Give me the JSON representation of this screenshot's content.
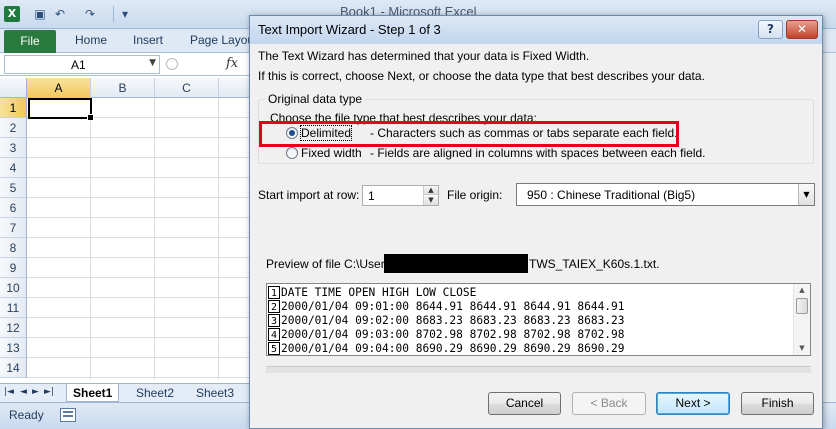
{
  "excel": {
    "window_title": "Book1 - Microsoft Excel",
    "app_logo": "X",
    "qat_icons": [
      "save-icon",
      "undo-icon",
      "redo-icon",
      "customize-qat-icon"
    ],
    "tabs": [
      "File",
      "Home",
      "Insert",
      "Page Layou"
    ],
    "name_box": "A1",
    "fx": "fx",
    "columns": [
      "A",
      "B",
      "C"
    ],
    "rows": [
      "1",
      "2",
      "3",
      "4",
      "5",
      "6",
      "7",
      "8",
      "9",
      "10",
      "11",
      "12",
      "13",
      "14"
    ],
    "sheets": [
      "Sheet1",
      "Sheet2",
      "Sheet3"
    ],
    "active_sheet": "Sheet1",
    "status": "Ready",
    "sheet_nav": [
      "|◄",
      "◄",
      "►",
      "►|"
    ]
  },
  "dialog": {
    "title": "Text Import Wizard - Step 1 of 3",
    "help_label": "?",
    "close_label": "✕",
    "intro_line1": "The Text Wizard has determined that your data is Fixed Width.",
    "intro_line2": "If this is correct, choose Next, or choose the data type that best describes your data.",
    "group_title": "Original data type",
    "group_desc": "Choose the file type that best describes your data:",
    "options": [
      {
        "label": "Delimited",
        "desc": "- Characters such as commas or tabs separate each field.",
        "checked": true
      },
      {
        "label": "Fixed width",
        "desc": "- Fields are aligned in columns with spaces between each field.",
        "checked": false
      }
    ],
    "start_row_label": "Start import at row:",
    "start_row_value": "1",
    "file_origin_label": "File origin:",
    "file_origin_value": "950 : Chinese Traditional (Big5)",
    "preview_prefix": "Preview of file C:\\Users\\",
    "preview_suffix": "TWS_TAIEX_K60s.1.txt.",
    "preview_lines": [
      {
        "n": "1",
        "text": "DATE TIME OPEN HIGH LOW CLOSE"
      },
      {
        "n": "2",
        "text": "2000/01/04 09:01:00 8644.91 8644.91 8644.91 8644.91"
      },
      {
        "n": "3",
        "text": "2000/01/04 09:02:00 8683.23 8683.23 8683.23 8683.23"
      },
      {
        "n": "4",
        "text": "2000/01/04 09:03:00 8702.98 8702.98 8702.98 8702.98"
      },
      {
        "n": "5",
        "text": "2000/01/04 09:04:00 8690.29 8690.29 8690.29 8690.29"
      }
    ],
    "buttons": {
      "cancel": "Cancel",
      "back": "< Back",
      "next": "Next >",
      "finish": "Finish"
    },
    "highlight_color": "#e3001b"
  }
}
